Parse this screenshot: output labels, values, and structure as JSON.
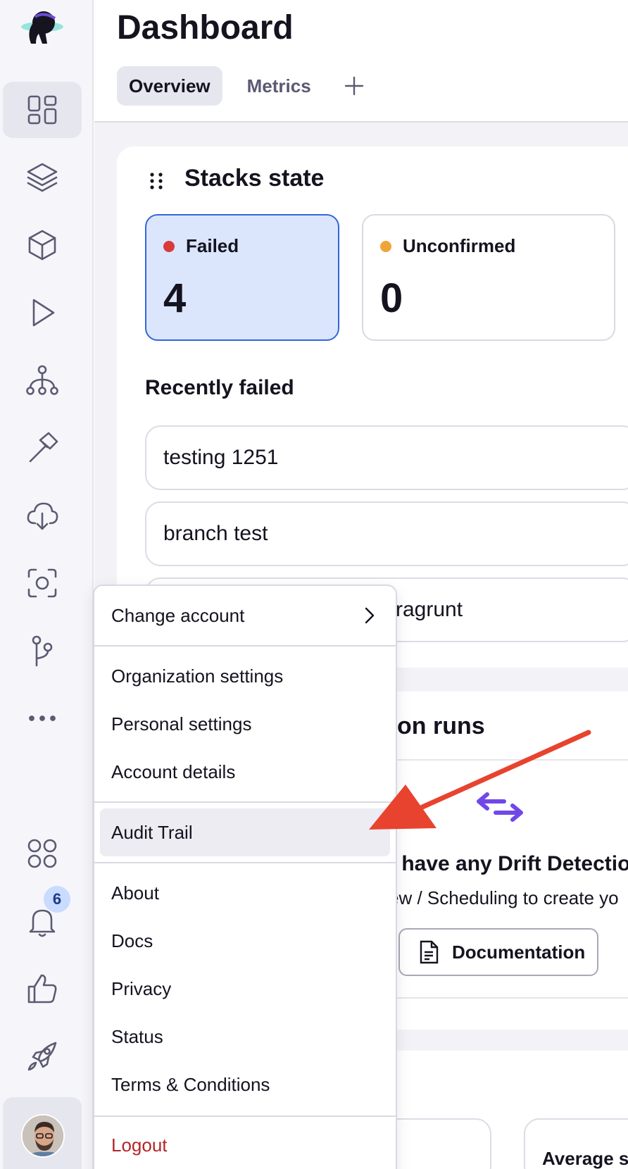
{
  "header": {
    "title": "Dashboard",
    "tabs": [
      {
        "label": "Overview",
        "active": true
      },
      {
        "label": "Metrics",
        "active": false
      }
    ],
    "add_tab_icon": "plus-icon"
  },
  "sidebar": {
    "logo_icon": "astronaut-logo",
    "items": [
      {
        "name": "dashboard",
        "icon": "dashboard-icon",
        "active": true
      },
      {
        "name": "stacks",
        "icon": "layers-icon"
      },
      {
        "name": "modules",
        "icon": "cube-icon"
      },
      {
        "name": "runs",
        "icon": "play-icon"
      },
      {
        "name": "resources",
        "icon": "hierarchy-icon"
      },
      {
        "name": "tools",
        "icon": "hammer-icon"
      },
      {
        "name": "cloud-integrations",
        "icon": "cloud-upload-icon"
      },
      {
        "name": "policies",
        "icon": "scan-icon"
      },
      {
        "name": "vcs",
        "icon": "git-branch-icon"
      },
      {
        "name": "more",
        "icon": "more-icon"
      },
      {
        "name": "apps",
        "icon": "apps-grid-icon"
      },
      {
        "name": "notifications",
        "icon": "bell-icon"
      },
      {
        "name": "feedback",
        "icon": "thumbs-up-icon"
      },
      {
        "name": "launchpad",
        "icon": "rocket-icon"
      }
    ],
    "notification_count": "6"
  },
  "stacks_state": {
    "title": "Stacks state",
    "tiles": [
      {
        "label": "Failed",
        "count": "4",
        "dot_color": "#d93a3a",
        "selected": true
      },
      {
        "label": "Unconfirmed",
        "count": "0",
        "dot_color": "#f0a437",
        "selected": false
      }
    ],
    "recently_failed_title": "Recently failed",
    "recently_failed": [
      "testing 1251",
      "branch test",
      "ragrunt"
    ]
  },
  "drift": {
    "title_fragment": "on runs",
    "empty_title": "t have any Drift Detectio",
    "empty_subtitle": "ew / Scheduling to create yo",
    "doc_button": "Documentation"
  },
  "metrics_fragment": {
    "average_label": "Average st"
  },
  "menu": {
    "change_account": "Change account",
    "group1": [
      "Organization settings",
      "Personal settings",
      "Account details"
    ],
    "audit_trail": "Audit Trail",
    "group3": [
      "About",
      "Docs",
      "Privacy",
      "Status",
      "Terms & Conditions"
    ],
    "logout": "Logout"
  },
  "colors": {
    "accent_blue": "#3465d9",
    "selected_bg": "#dbe6fd",
    "annotation_arrow": "#e8432e",
    "drift_icon": "#7048e8",
    "logout": "#b3262a"
  }
}
